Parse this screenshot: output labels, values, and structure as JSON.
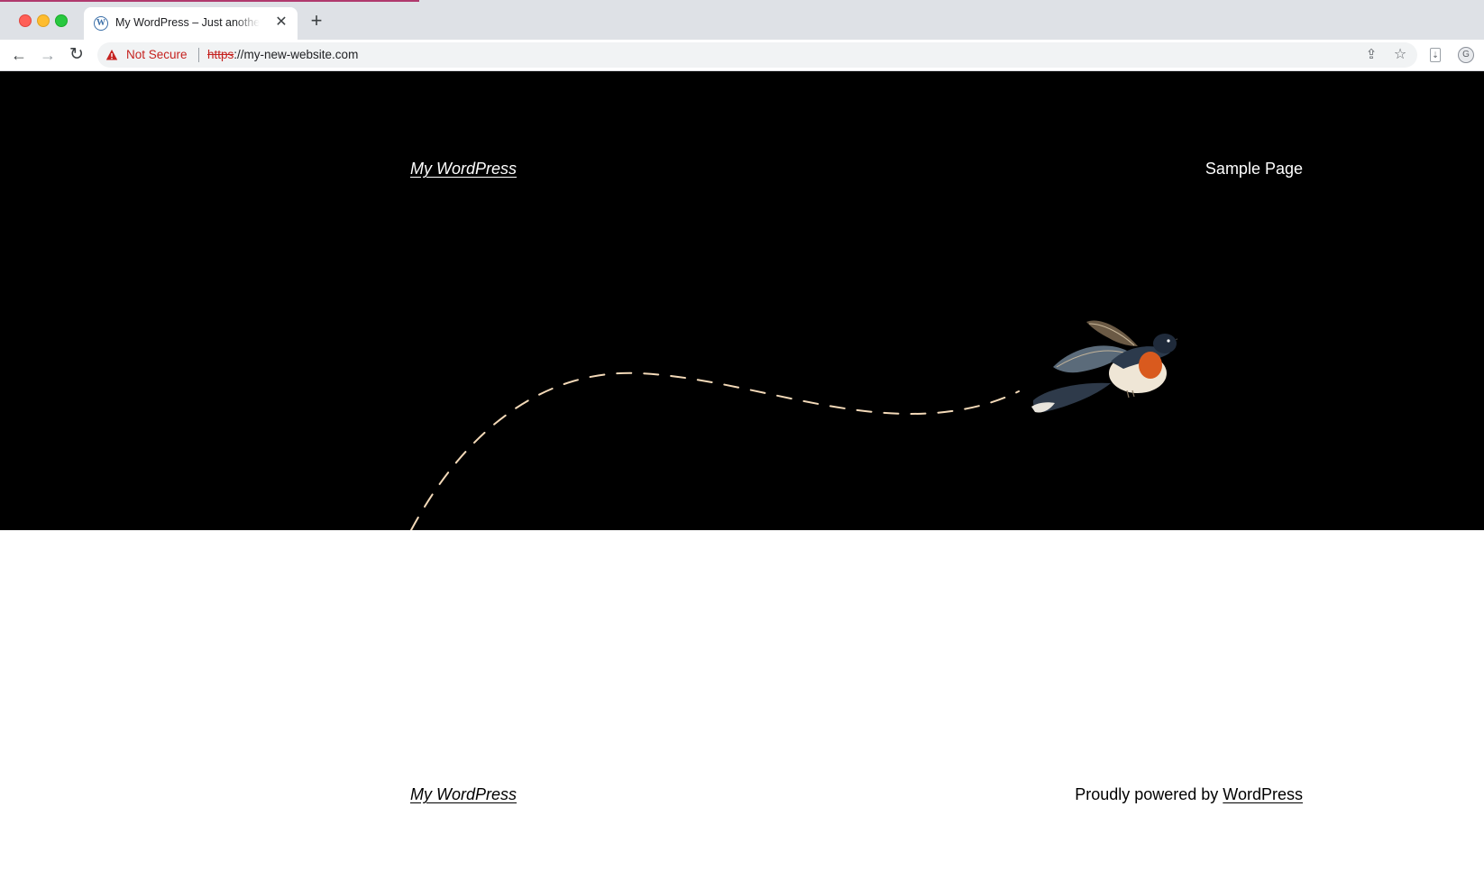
{
  "browser": {
    "tab": {
      "title": "My WordPress – Just another WordPress site",
      "favicon": "wordpress-icon",
      "close_glyph": "✕"
    },
    "new_tab_glyph": "+",
    "toolbar": {
      "back_glyph": "←",
      "forward_glyph": "→",
      "reload_glyph": "↻",
      "security_label": "Not Secure",
      "url_scheme": "https",
      "url_rest": "://my-new-website.com",
      "share_glyph": "⇪",
      "star_glyph": "☆"
    },
    "colors": {
      "tab_strip": "#dee1e6",
      "not_secure": "#c5221f"
    }
  },
  "page": {
    "header": {
      "site_title": "My WordPress",
      "nav_items": [
        "Sample Page"
      ]
    },
    "hero": {
      "background": "#000000",
      "illustration": "flying-bird-with-dashed-flight-path"
    },
    "footer": {
      "site_title": "My WordPress",
      "powered_prefix": "Proudly powered by ",
      "powered_link": "WordPress"
    }
  }
}
